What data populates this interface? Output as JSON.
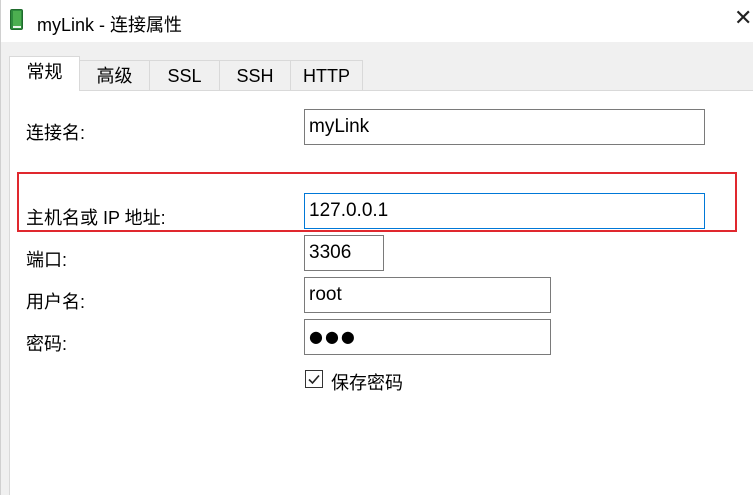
{
  "window": {
    "title": "myLink - 连接属性",
    "close_glyph": "✕",
    "app_icon": "database-book-icon",
    "app_icon_color": "#2e8b3d"
  },
  "tabs": [
    {
      "label": "常规",
      "active": true
    },
    {
      "label": "高级",
      "active": false
    },
    {
      "label": "SSL",
      "active": false
    },
    {
      "label": "SSH",
      "active": false
    },
    {
      "label": "HTTP",
      "active": false
    }
  ],
  "form": {
    "connection_name": {
      "label": "连接名:",
      "value": "myLink"
    },
    "host": {
      "label": "主机名或 IP 地址:",
      "value": "127.0.0.1"
    },
    "port": {
      "label": "端口:",
      "value": "3306"
    },
    "username": {
      "label": "用户名:",
      "value": "root"
    },
    "password": {
      "label": "密码:",
      "value": "●●●"
    },
    "save_password": {
      "label": "保存密码",
      "checked": true
    }
  },
  "colors": {
    "highlight_border": "#e0282e",
    "focus_border": "#0078d7"
  }
}
